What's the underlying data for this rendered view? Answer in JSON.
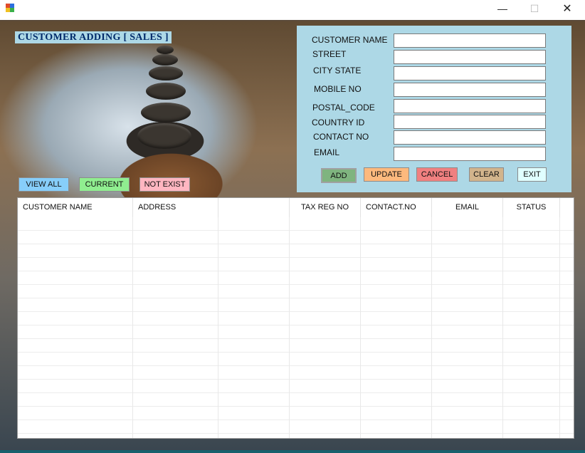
{
  "window": {
    "minimize_glyph": "—",
    "maximize_glyph": "☐",
    "close_glyph": "✕"
  },
  "heading": "CUSTOMER  ADDING [ SALES ]",
  "form": {
    "labels": [
      "CUSTOMER NAME",
      "STREET",
      "CITY STATE",
      "MOBILE NO",
      "POSTAL_CODE",
      "COUNTRY ID",
      "CONTACT NO",
      "EMAIL"
    ],
    "values": [
      "",
      "",
      "",
      "",
      "",
      "",
      "",
      ""
    ]
  },
  "buttons": {
    "add": {
      "label": "ADD",
      "color": "#7fb47f"
    },
    "update": {
      "label": "UPDATE",
      "color": "#fdb97d"
    },
    "cancel": {
      "label": "CANCEL",
      "color": "#f08080"
    },
    "clear": {
      "label": "CLEAR",
      "color": "#d2b48c"
    },
    "exit": {
      "label": "EXIT",
      "color": "#e0ffff"
    }
  },
  "filters": {
    "view_all": {
      "label": "VIEW ALL",
      "color": "#87cefa"
    },
    "current": {
      "label": "CURRENT",
      "color": "#90ee90"
    },
    "not_exist": {
      "label": "NOT EXIST",
      "color": "#ffb6c1"
    }
  },
  "grid": {
    "columns": [
      "CUSTOMER NAME",
      "ADDRESS",
      "",
      "TAX REG NO",
      "CONTACT.NO",
      "EMAIL",
      "STATUS"
    ],
    "rows": []
  },
  "colors": {
    "panel": "#add8e6",
    "heading_text": "#002b6b",
    "taskbar_accent": "#17606d"
  }
}
